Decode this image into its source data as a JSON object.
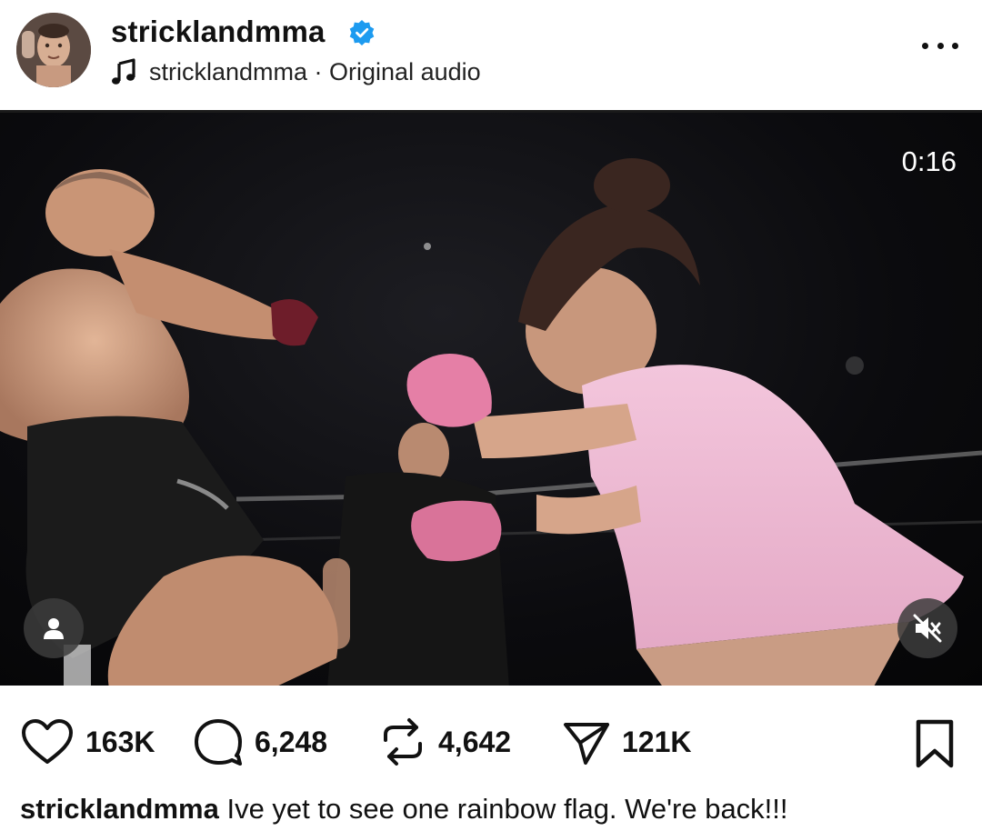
{
  "post": {
    "username": "stricklandmma",
    "audio": "stricklandmma · Original audio",
    "verified": true
  },
  "video": {
    "timestamp": "0:16"
  },
  "actions": {
    "likes": "163K",
    "comments": "6,248",
    "reposts": "4,642",
    "shares": "121K"
  },
  "caption": {
    "username": "stricklandmma",
    "text": "Ive yet to see one rainbow flag. We're back!!!"
  },
  "icons": {
    "verified": "verified-badge-icon",
    "audio": "music-note-icon",
    "more": "more-horizontal-icon",
    "tag": "user-tag-icon",
    "mute": "muted-speaker-icon",
    "like": "heart-icon",
    "comment": "comment-bubble-icon",
    "repost": "repost-icon",
    "share": "paper-plane-icon",
    "save": "bookmark-icon"
  },
  "colors": {
    "verified_blue": "#1d9bf0",
    "text": "#111111"
  }
}
